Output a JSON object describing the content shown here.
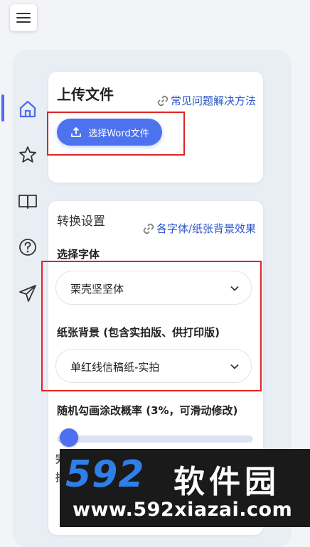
{
  "upload": {
    "title": "上传文件",
    "faq_link": "常见问题解决方法",
    "button_label": "选择Word文件"
  },
  "settings": {
    "title": "转换设置",
    "effects_link": "各字体/纸张背景效果",
    "font_label": "选择字体",
    "font_value": "栗壳坚坚体",
    "paper_label": "纸张背景 (包含实拍版、供打印版)",
    "paper_value": "单红线信稿纸-实拍",
    "doodle_label": "随机勾画涂改概率 (3%，可滑动修改)",
    "doodle_percent": 3,
    "cut_line1": "完",
    "cut_line2": "插"
  },
  "rail": {
    "items": [
      "home-icon",
      "star-icon",
      "book-icon",
      "help-icon",
      "send-icon"
    ],
    "active": "home-icon"
  },
  "watermark": {
    "logo": "592",
    "name": "软件园",
    "url": "www.592xiazai.com"
  },
  "colors": {
    "accent": "#4d72ee",
    "link": "#2d55c8",
    "highlight": "#e02424"
  }
}
